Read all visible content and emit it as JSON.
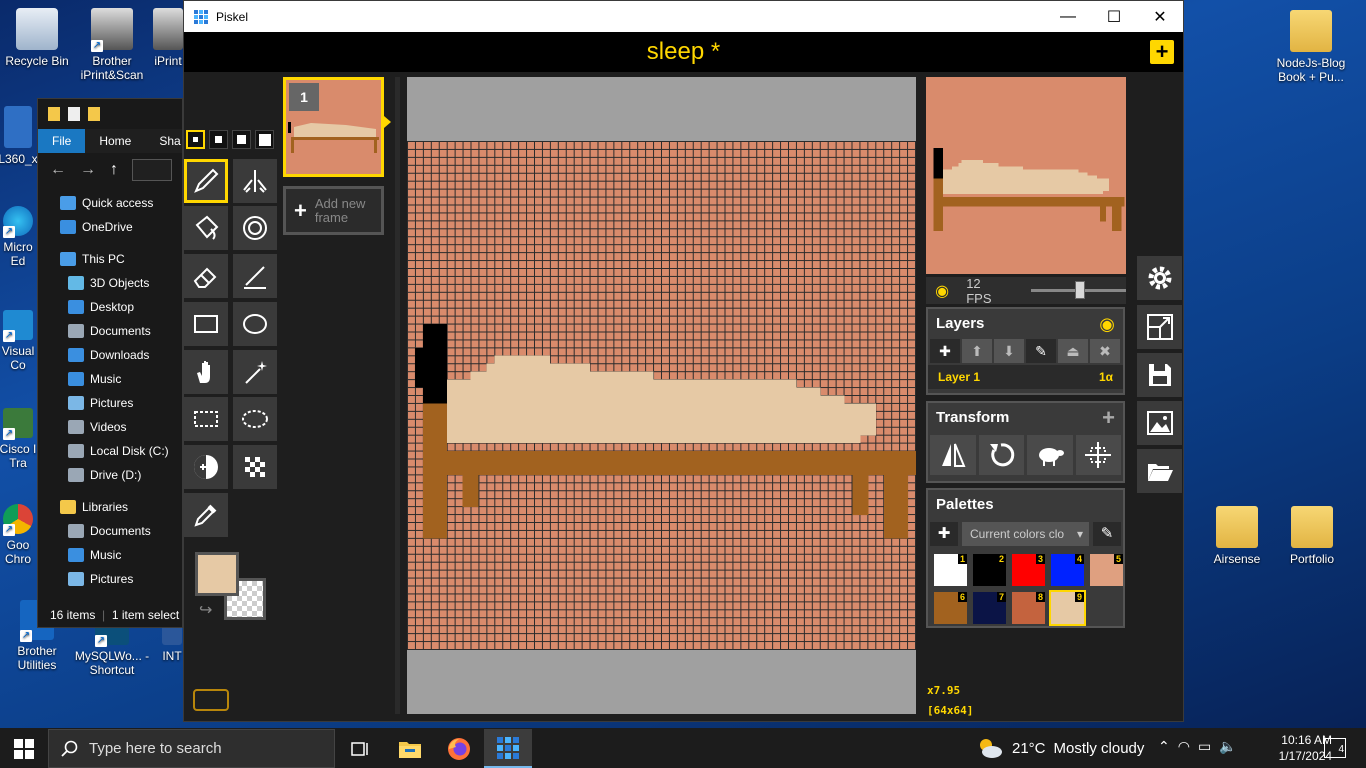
{
  "desktop": {
    "icons_left": [
      {
        "label": "Recycle Bin"
      },
      {
        "label": "Brother iPrint&Scan"
      },
      {
        "label": "iPrint"
      },
      {
        "label": "L360_x"
      },
      {
        "label": "Micro Ed"
      },
      {
        "label": "Visual Co"
      },
      {
        "label": "Cisco I Tra"
      },
      {
        "label": "Goo Chro"
      },
      {
        "label": "Brother Utilities"
      },
      {
        "label": "MySQLWo... - Shortcut"
      },
      {
        "label": "INT"
      }
    ],
    "icons_right": [
      {
        "label": "NodeJs-Blog Book + Pu..."
      },
      {
        "label": "Airsense"
      },
      {
        "label": "Portfolio"
      }
    ]
  },
  "explorer": {
    "ribbon_tabs": [
      "File",
      "Home",
      "Sha"
    ],
    "nav": [
      {
        "label": "Quick access",
        "color": "#4a9de8"
      },
      {
        "label": "OneDrive",
        "color": "#3a8fe0"
      },
      {
        "label": "This PC",
        "color": "#4a9de8"
      },
      {
        "label": "3D Objects",
        "color": "#63b9e6"
      },
      {
        "label": "Desktop",
        "color": "#3a8fe0"
      },
      {
        "label": "Documents",
        "color": "#9aa7b5"
      },
      {
        "label": "Downloads",
        "color": "#3a8fe0"
      },
      {
        "label": "Music",
        "color": "#3a8fe0"
      },
      {
        "label": "Pictures",
        "color": "#7bb7e6"
      },
      {
        "label": "Videos",
        "color": "#9aa7b5"
      },
      {
        "label": "Local Disk (C:)",
        "color": "#9aa7b5"
      },
      {
        "label": "Drive (D:)",
        "color": "#9aa7b5"
      },
      {
        "label": "Libraries",
        "color": "#f4c84a"
      },
      {
        "label": "Documents",
        "color": "#9aa7b5"
      },
      {
        "label": "Music",
        "color": "#3a8fe0"
      },
      {
        "label": "Pictures",
        "color": "#7bb7e6"
      }
    ],
    "status_items": "16 items",
    "status_selected": "1 item select"
  },
  "piskel": {
    "window_title": "Piskel",
    "doc_title": "sleep *",
    "new_button": "+",
    "frames": [
      {
        "number": "1"
      }
    ],
    "add_frame_label": "Add new frame",
    "fps_label": "12 FPS",
    "fps_value": 12,
    "layers_title": "Layers",
    "layer_name": "Layer 1",
    "layer_opacity": "1α",
    "transform_title": "Transform",
    "palettes_title": "Palettes",
    "palette_select": "Current colors clo",
    "swatches": [
      {
        "index": "1",
        "color": "#ffffff"
      },
      {
        "index": "2",
        "color": "#000000"
      },
      {
        "index": "3",
        "color": "#ff0000"
      },
      {
        "index": "4",
        "color": "#0022ff"
      },
      {
        "index": "5",
        "color": "#dfa080"
      },
      {
        "index": "6",
        "color": "#a2621f"
      },
      {
        "index": "7",
        "color": "#0b1446"
      },
      {
        "index": "8",
        "color": "#c4633e"
      },
      {
        "index": "9",
        "color": "#e6c9a5"
      }
    ],
    "primary_color": "#e6c9a5",
    "zoom": "x7.95",
    "dimensions": "[64x64]",
    "accent": "#ffd700"
  },
  "taskbar": {
    "search_placeholder": "Type here to search",
    "weather_temp": "21°C",
    "weather_desc": "Mostly cloudy",
    "time": "10:16 AM",
    "date": "1/17/2024",
    "notifications": "4"
  }
}
